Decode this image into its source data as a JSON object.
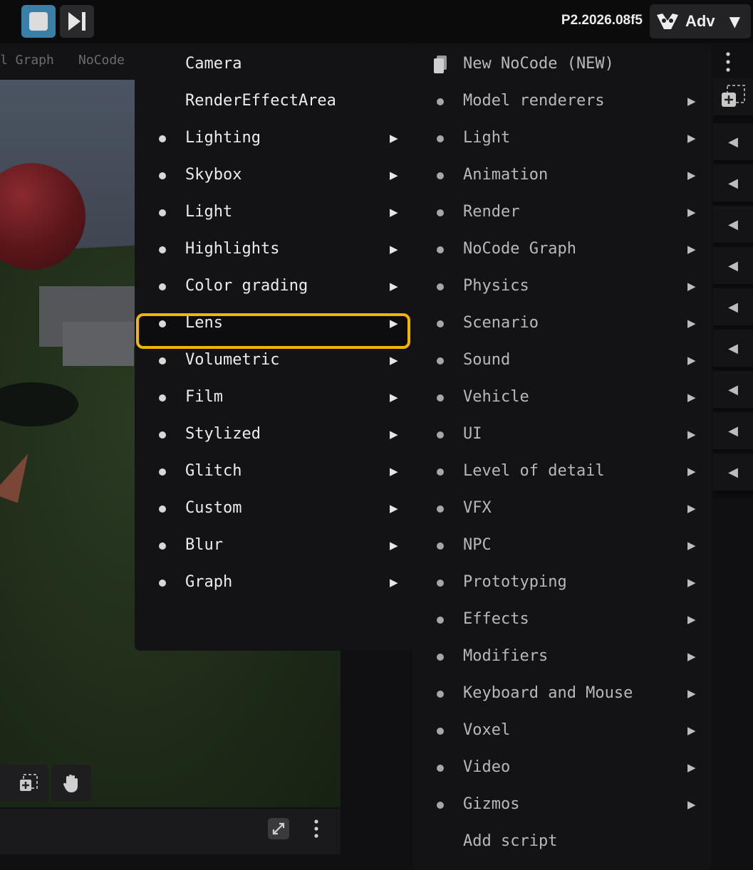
{
  "topbar": {
    "version": "P2.2026.08f5",
    "mode_label": "Adv"
  },
  "tabs": [
    {
      "label": "l Graph"
    },
    {
      "label": "NoCode"
    }
  ],
  "menu_left": {
    "items": [
      {
        "label": "Camera",
        "bullet": false,
        "submenu": false
      },
      {
        "label": "RenderEffectArea",
        "bullet": false,
        "submenu": false
      },
      {
        "label": "Lighting",
        "bullet": true,
        "submenu": true
      },
      {
        "label": "Skybox",
        "bullet": true,
        "submenu": true
      },
      {
        "label": "Light",
        "bullet": true,
        "submenu": true
      },
      {
        "label": "Highlights",
        "bullet": true,
        "submenu": true
      },
      {
        "label": "Color grading",
        "bullet": true,
        "submenu": true
      },
      {
        "label": "Lens",
        "bullet": true,
        "submenu": true,
        "highlighted": true
      },
      {
        "label": "Volumetric",
        "bullet": true,
        "submenu": true
      },
      {
        "label": "Film",
        "bullet": true,
        "submenu": true
      },
      {
        "label": "Stylized",
        "bullet": true,
        "submenu": true
      },
      {
        "label": "Glitch",
        "bullet": true,
        "submenu": true
      },
      {
        "label": "Custom",
        "bullet": true,
        "submenu": true
      },
      {
        "label": "Blur",
        "bullet": true,
        "submenu": true
      },
      {
        "label": "Graph",
        "bullet": true,
        "submenu": true
      }
    ]
  },
  "menu_right": {
    "items": [
      {
        "label": "New NoCode (NEW)",
        "icon": "document-icon",
        "submenu": false
      },
      {
        "label": "Model renderers",
        "bullet": true,
        "submenu": true
      },
      {
        "label": "Light",
        "bullet": true,
        "submenu": true
      },
      {
        "label": "Animation",
        "bullet": true,
        "submenu": true
      },
      {
        "label": "Render",
        "bullet": true,
        "submenu": true
      },
      {
        "label": "NoCode Graph",
        "bullet": true,
        "submenu": true
      },
      {
        "label": "Physics",
        "bullet": true,
        "submenu": true
      },
      {
        "label": "Scenario",
        "bullet": true,
        "submenu": true
      },
      {
        "label": "Sound",
        "bullet": true,
        "submenu": true
      },
      {
        "label": "Vehicle",
        "bullet": true,
        "submenu": true
      },
      {
        "label": "UI",
        "bullet": true,
        "submenu": true
      },
      {
        "label": "Level of detail",
        "bullet": true,
        "submenu": true
      },
      {
        "label": "VFX",
        "bullet": true,
        "submenu": true
      },
      {
        "label": "NPC",
        "bullet": true,
        "submenu": true
      },
      {
        "label": "Prototyping",
        "bullet": true,
        "submenu": true
      },
      {
        "label": "Effects",
        "bullet": true,
        "submenu": true
      },
      {
        "label": "Modifiers",
        "bullet": true,
        "submenu": true
      },
      {
        "label": "Keyboard and Mouse",
        "bullet": true,
        "submenu": true
      },
      {
        "label": "Voxel",
        "bullet": true,
        "submenu": true
      },
      {
        "label": "Video",
        "bullet": true,
        "submenu": true
      },
      {
        "label": "Gizmos",
        "bullet": true,
        "submenu": true
      },
      {
        "label": "Add script",
        "bullet": false,
        "submenu": false
      }
    ]
  },
  "colors": {
    "highlight_border": "#f5b400",
    "play_button": "#3a7fa8",
    "menu_bg": "#131316"
  },
  "icons": [
    "stop-icon",
    "step-forward-icon",
    "visor-logo-icon",
    "chevron-down-icon",
    "kebab-menu-icon",
    "add-component-icon",
    "collapse-arrow-icon",
    "hand-tool-icon",
    "expand-icon"
  ]
}
